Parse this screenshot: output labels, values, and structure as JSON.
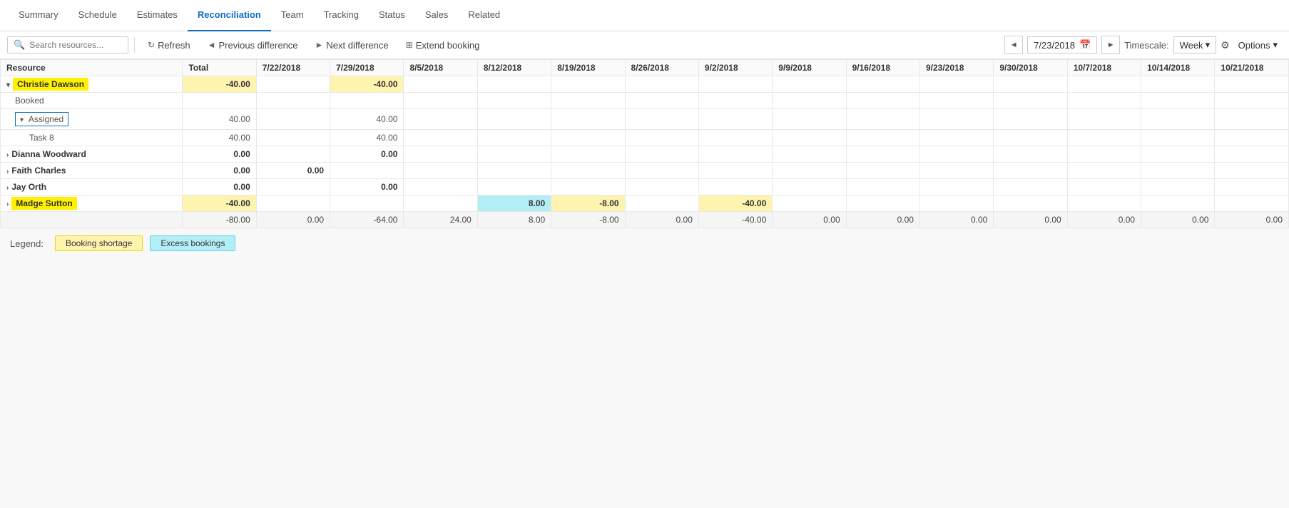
{
  "nav": {
    "items": [
      {
        "id": "summary",
        "label": "Summary",
        "active": false
      },
      {
        "id": "schedule",
        "label": "Schedule",
        "active": false
      },
      {
        "id": "estimates",
        "label": "Estimates",
        "active": false
      },
      {
        "id": "reconciliation",
        "label": "Reconciliation",
        "active": true
      },
      {
        "id": "team",
        "label": "Team",
        "active": false
      },
      {
        "id": "tracking",
        "label": "Tracking",
        "active": false
      },
      {
        "id": "status",
        "label": "Status",
        "active": false
      },
      {
        "id": "sales",
        "label": "Sales",
        "active": false
      },
      {
        "id": "related",
        "label": "Related",
        "active": false
      }
    ]
  },
  "toolbar": {
    "search_placeholder": "Search resources...",
    "refresh_label": "Refresh",
    "prev_diff_label": "Previous difference",
    "next_diff_label": "Next difference",
    "extend_booking_label": "Extend booking",
    "date_value": "7/23/2018",
    "timescale_label": "Timescale:",
    "timescale_value": "Week",
    "options_label": "Options"
  },
  "grid": {
    "headers": [
      "Resource",
      "Total",
      "7/22/2018",
      "7/29/2018",
      "8/5/2018",
      "8/12/2018",
      "8/19/2018",
      "8/26/2018",
      "9/2/2018",
      "9/9/2018",
      "9/16/2018",
      "9/23/2018",
      "9/30/2018",
      "10/7/2018",
      "10/14/2018",
      "10/21/2018"
    ],
    "rows": [
      {
        "type": "resource",
        "name": "Christie Dawson",
        "highlight": "yellow",
        "expanded": true,
        "values": [
          "",
          "-40.00",
          "",
          "-40.00",
          "",
          "",
          "",
          "",
          "",
          "",
          "",
          "",
          "",
          "",
          "",
          ""
        ]
      },
      {
        "type": "sub",
        "name": "Booked",
        "indent": 1,
        "values": [
          "",
          "",
          "",
          "",
          "",
          "",
          "",
          "",
          "",
          "",
          "",
          "",
          "",
          "",
          "",
          ""
        ]
      },
      {
        "type": "sub",
        "name": "Assigned",
        "indent": 1,
        "bordered": true,
        "values": [
          "",
          "40.00",
          "",
          "40.00",
          "",
          "",
          "",
          "",
          "",
          "",
          "",
          "",
          "",
          "",
          "",
          ""
        ]
      },
      {
        "type": "task",
        "name": "Task 8",
        "indent": 2,
        "values": [
          "",
          "40.00",
          "",
          "40.00",
          "",
          "",
          "",
          "",
          "",
          "",
          "",
          "",
          "",
          "",
          "",
          ""
        ]
      },
      {
        "type": "resource",
        "name": "Dianna Woodward",
        "highlight": "none",
        "expanded": false,
        "values": [
          "",
          "0.00",
          "",
          "0.00",
          "",
          "",
          "",
          "",
          "",
          "",
          "",
          "",
          "",
          "",
          "",
          ""
        ]
      },
      {
        "type": "resource",
        "name": "Faith Charles",
        "highlight": "none",
        "expanded": false,
        "values": [
          "",
          "0.00",
          "0.00",
          "",
          "",
          "",
          "",
          "",
          "",
          "",
          "",
          "",
          "",
          "",
          "",
          ""
        ]
      },
      {
        "type": "resource",
        "name": "Jay Orth",
        "highlight": "none",
        "expanded": false,
        "values": [
          "",
          "0.00",
          "",
          "0.00",
          "",
          "",
          "",
          "",
          "",
          "",
          "",
          "",
          "",
          "",
          "",
          ""
        ]
      },
      {
        "type": "resource",
        "name": "Madge Sutton",
        "highlight": "yellow",
        "expanded": false,
        "values": [
          "",
          "-40.00",
          "",
          "",
          "",
          "8.00",
          "-8.00",
          "",
          "-40.00",
          "",
          "",
          "",
          "",
          "",
          "",
          ""
        ],
        "cell_highlights": {
          "5": "cyan",
          "6": "yellow",
          "8": "yellow",
          "1": "yellow"
        }
      },
      {
        "type": "total",
        "name": "",
        "values": [
          "",
          "-80.00",
          "0.00",
          "-64.00",
          "24.00",
          "8.00",
          "-8.00",
          "0.00",
          "-40.00",
          "0.00",
          "0.00",
          "0.00",
          "0.00",
          "0.00",
          "0.00",
          "0.00"
        ]
      }
    ]
  },
  "legend": {
    "label": "Legend:",
    "items": [
      {
        "id": "booking-shortage",
        "label": "Booking shortage",
        "style": "yellow"
      },
      {
        "id": "excess-bookings",
        "label": "Excess bookings",
        "style": "cyan"
      }
    ]
  }
}
